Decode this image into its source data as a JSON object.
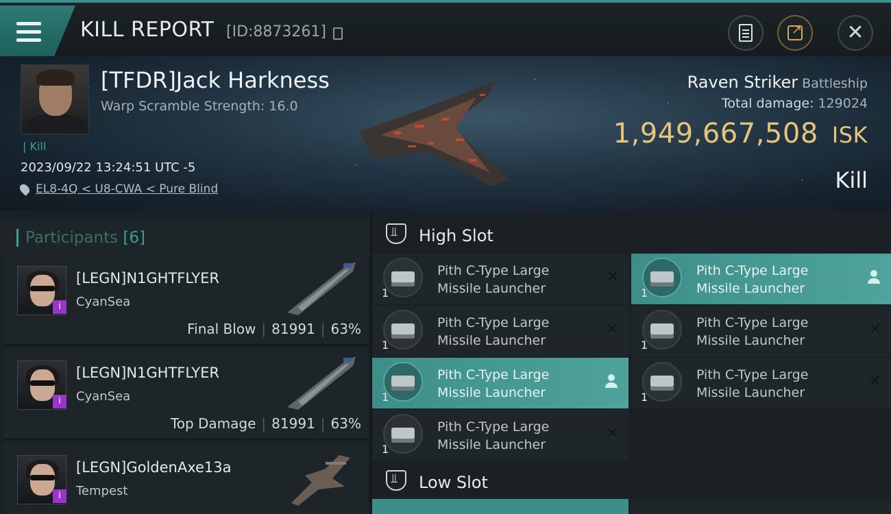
{
  "header": {
    "title": "KILL REPORT",
    "report_id": "[ID:8873261]"
  },
  "victim": {
    "name": "[TFDR]Jack Harkness",
    "warp_scramble": "Warp Scramble Strength: 16.0",
    "tag": "Kill",
    "datetime": "2023/09/22 13:24:51 UTC -5",
    "location": "EL8-4Q < U8-CWA < Pure Blind"
  },
  "ship": {
    "name": "Raven Striker",
    "class": "Battleship",
    "total_damage_label": "Total damage:",
    "total_damage": "129024",
    "value": "1,949,667,508",
    "currency": "ISK",
    "result": "Kill"
  },
  "participants": {
    "label": "Participants",
    "count": "[6]",
    "items": [
      {
        "name": "[LEGN]N1GHTFLYER",
        "ship": "CyanSea",
        "role": "Final Blow",
        "damage": "81991",
        "percent": "63%",
        "badge": "i"
      },
      {
        "name": "[LEGN]N1GHTFLYER",
        "ship": "CyanSea",
        "role": "Top Damage",
        "damage": "81991",
        "percent": "63%",
        "badge": "i"
      },
      {
        "name": "[LEGN]GoldenAxe13a",
        "ship": "Tempest",
        "badge": "i"
      }
    ]
  },
  "slots": {
    "high_title": "High Slot",
    "low_title": "Low Slot",
    "high": [
      {
        "line1": "Pith C-Type Large",
        "line2": "Missile Launcher",
        "qty": "1",
        "status": "destroyed"
      },
      {
        "line1": "Pith C-Type Large",
        "line2": "Missile Launcher",
        "qty": "1",
        "status": "dropped"
      },
      {
        "line1": "Pith C-Type Large",
        "line2": "Missile Launcher",
        "qty": "1",
        "status": "destroyed"
      },
      {
        "line1": "Pith C-Type Large",
        "line2": "Missile Launcher",
        "qty": "1",
        "status": "destroyed"
      },
      {
        "line1": "Pith C-Type Large",
        "line2": "Missile Launcher",
        "qty": "1",
        "status": "dropped"
      },
      {
        "line1": "Pith C-Type Large",
        "line2": "Missile Launcher",
        "qty": "1",
        "status": "destroyed"
      },
      {
        "line1": "Pith C-Type Large",
        "line2": "Missile Launcher",
        "qty": "1",
        "status": "destroyed"
      }
    ]
  },
  "colors": {
    "accent": "#3a9f96",
    "isk": "#e6c47b",
    "highlight": "#4fa39c",
    "badge": "#9b35c7"
  },
  "icons": [
    "menu-icon",
    "copy-icon",
    "clipboard-icon",
    "share-icon",
    "close-icon",
    "location-pin-icon",
    "slot-icon",
    "destroyed-x-icon",
    "dropped-person-icon"
  ]
}
